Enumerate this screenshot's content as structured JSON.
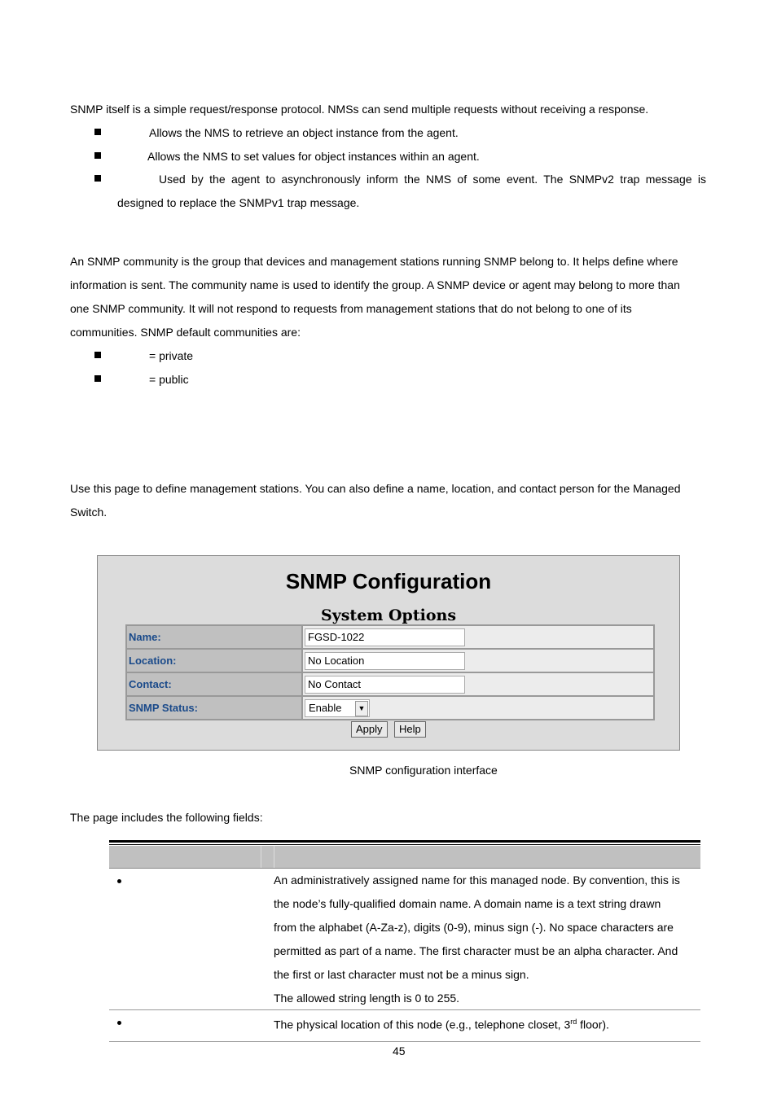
{
  "intro": {
    "text": "SNMP itself is a simple request/response protocol. NMSs can send multiple requests without receiving a response.",
    "bullets": [
      "Allows the NMS to retrieve an object instance from the agent.",
      "Allows the NMS to set values for object instances within an agent.",
      "Used by the agent to asynchronously inform the NMS of some event. The SNMPv2 trap message is"
    ],
    "bullet3_cont": "designed to replace the SNMPv1 trap message."
  },
  "community": {
    "lines": [
      "An SNMP community is the group that devices and management stations running SNMP belong to. It helps define where",
      "information is sent. The community name is used to identify the group. A SNMP device or agent may belong to more than",
      "one SNMP community. It will not respond to requests from management stations that do not belong to one of its",
      "communities. SNMP default communities are:"
    ],
    "bullets": [
      "= private",
      "= public"
    ]
  },
  "usepage": {
    "lines": [
      "Use this page to define management stations. You can also define a name, location, and contact person for the Managed",
      "Switch."
    ]
  },
  "snmp_panel": {
    "title": "SNMP Configuration",
    "subtitle": "System Options",
    "fields": [
      {
        "label": "Name:",
        "value": "FGSD-1022"
      },
      {
        "label": "Location:",
        "value": "No Location"
      },
      {
        "label": "Contact:",
        "value": "No Contact"
      }
    ],
    "status": {
      "label": "SNMP Status:",
      "value": "Enable"
    },
    "apply": "Apply",
    "help": "Help"
  },
  "caption": "SNMP configuration interface",
  "fields_intro": "The page includes the following fields:",
  "fields_table": {
    "rows": [
      {
        "lines": [
          "An administratively assigned name for this managed node. By convention, this is",
          "the node’s fully-qualified domain name. A domain name is a text string drawn",
          "from the alphabet (A-Za-z), digits (0-9), minus sign (-). No space characters are",
          "permitted as part of a name. The first character must be an alpha character. And",
          "the first or last character must not be a minus sign.",
          "The allowed string length is 0 to 255."
        ]
      },
      {
        "pre": "The physical location of this node (e.g., telephone closet, 3",
        "sup": "rd",
        "post": " floor)."
      }
    ]
  },
  "page_number": "45"
}
